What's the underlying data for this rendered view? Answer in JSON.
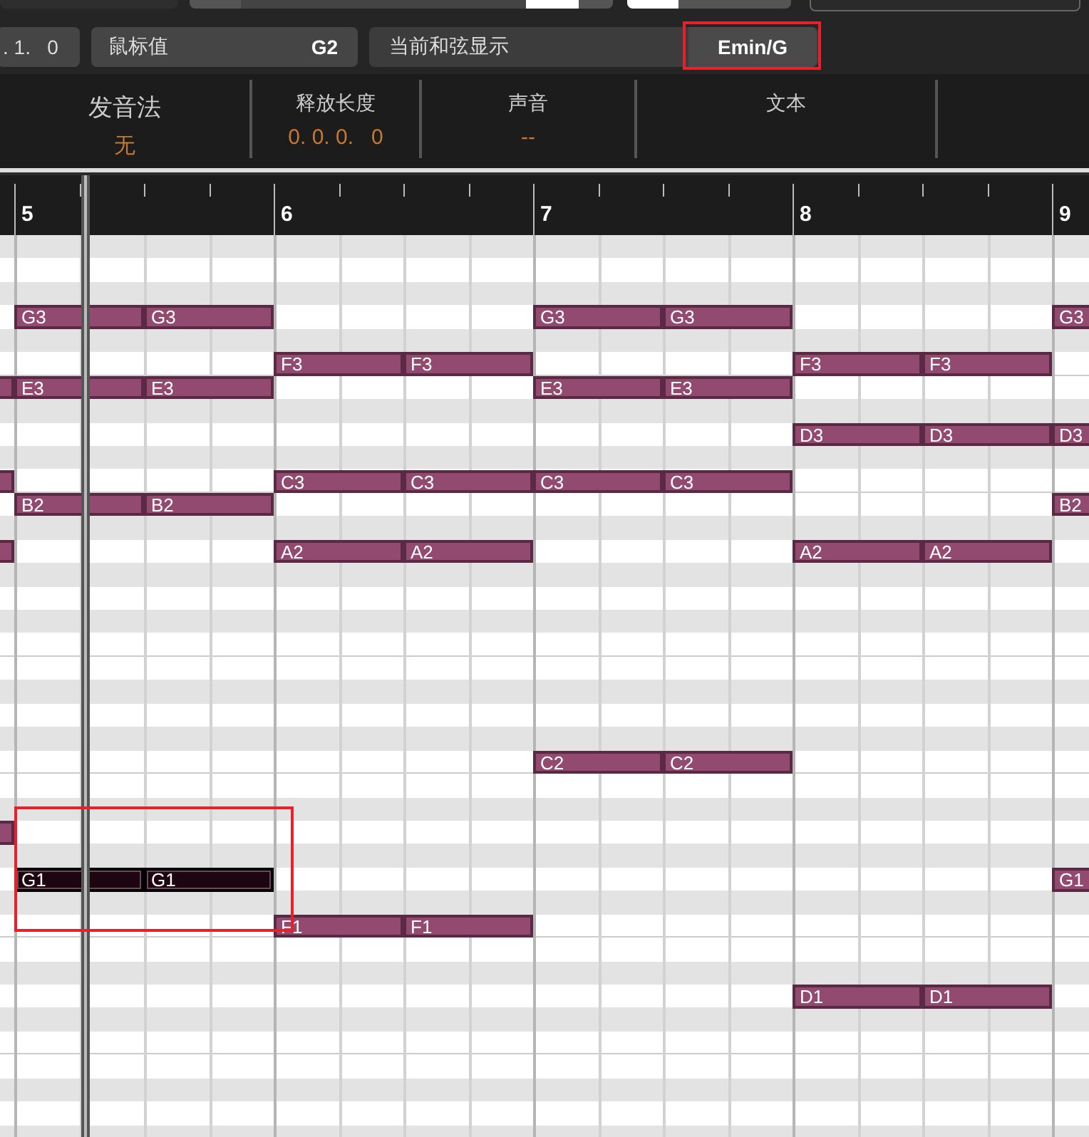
{
  "toolbar": {
    "position_field": ". 1.   0",
    "mouse_value": {
      "label": "鼠标值",
      "value": "G2"
    },
    "chord_display": {
      "label": "当前和弦显示",
      "value": "Emin/G",
      "highlighted": true
    }
  },
  "info_columns": [
    {
      "title": "发音法",
      "value": "无",
      "kind": "orange"
    },
    {
      "title": "释放长度",
      "value": "0. 0. 0.   0",
      "kind": "orange"
    },
    {
      "title": "声音",
      "value": "--",
      "kind": "orange"
    },
    {
      "title": "文本",
      "kind": "empty"
    }
  ],
  "ruler": {
    "bars": [
      "5",
      "6",
      "7",
      "8",
      "9"
    ]
  },
  "grid": {
    "selection_outlined": true,
    "notes": [
      {
        "selected": false
      },
      {
        "selected": false
      },
      {
        "selected": false
      },
      {
        "selected": false
      },
      {
        "label": "G3",
        "selected": false
      },
      {
        "label": "G3",
        "selected": false
      },
      {
        "label": "E3",
        "selected": false
      },
      {
        "label": "E3",
        "selected": false
      },
      {
        "label": "B2",
        "selected": false
      },
      {
        "label": "B2",
        "selected": false
      },
      {
        "label": "G1",
        "selected": true
      },
      {
        "label": "G1",
        "selected": true
      },
      {
        "label": "F3",
        "selected": false
      },
      {
        "label": "F3",
        "selected": false
      },
      {
        "label": "C3",
        "selected": false
      },
      {
        "label": "C3",
        "selected": false
      },
      {
        "label": "A2",
        "selected": false
      },
      {
        "label": "A2",
        "selected": false
      },
      {
        "label": "F1",
        "selected": false
      },
      {
        "label": "F1",
        "selected": false
      },
      {
        "label": "G3",
        "selected": false
      },
      {
        "label": "G3",
        "selected": false
      },
      {
        "label": "E3",
        "selected": false
      },
      {
        "label": "E3",
        "selected": false
      },
      {
        "label": "C3",
        "selected": false
      },
      {
        "label": "C3",
        "selected": false
      },
      {
        "label": "C2",
        "selected": false
      },
      {
        "label": "C2",
        "selected": false
      },
      {
        "label": "F3",
        "selected": false
      },
      {
        "label": "F3",
        "selected": false
      },
      {
        "label": "D3",
        "selected": false
      },
      {
        "label": "D3",
        "selected": false
      },
      {
        "label": "A2",
        "selected": false
      },
      {
        "label": "A2",
        "selected": false
      },
      {
        "label": "D1",
        "selected": false
      },
      {
        "label": "D1",
        "selected": false
      },
      {
        "label": "G3",
        "selected": false
      },
      {
        "label": "D3",
        "selected": false
      },
      {
        "label": "B2",
        "selected": false
      },
      {
        "label": "G1",
        "selected": false
      }
    ]
  }
}
